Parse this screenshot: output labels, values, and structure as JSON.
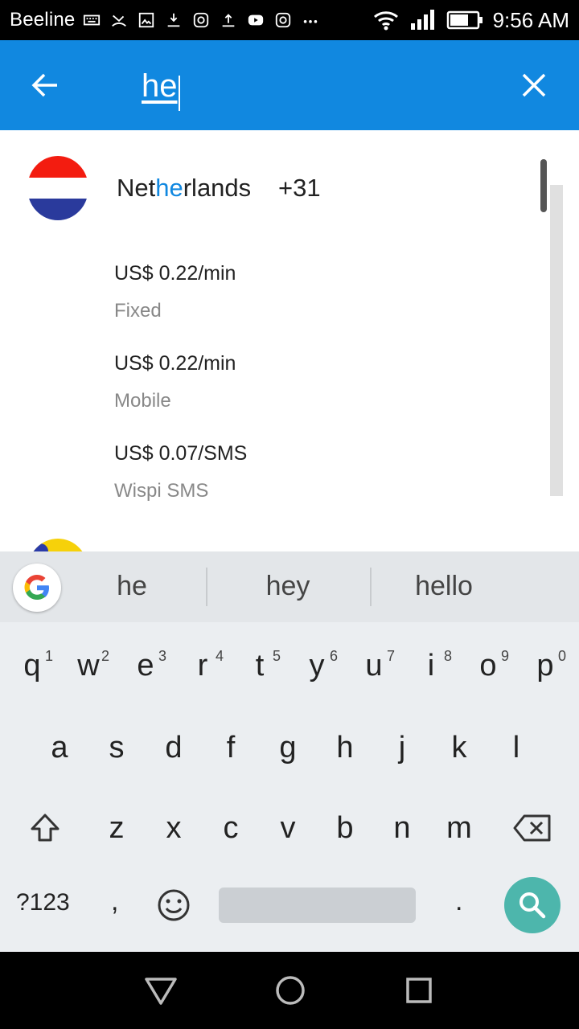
{
  "status_bar": {
    "carrier": "Beeline",
    "time": "9:56 AM"
  },
  "toolbar": {
    "search_value": "he",
    "back_icon": "arrow-left-icon",
    "clear_icon": "close-icon"
  },
  "results": {
    "country_prefix": "Net",
    "country_match": "he",
    "country_suffix": "rlands",
    "dial_code": "+31",
    "rates": [
      {
        "price": "US$ 0.22/min",
        "type": "Fixed"
      },
      {
        "price": "US$ 0.22/min",
        "type": "Mobile"
      },
      {
        "price": "US$ 0.07/SMS",
        "type": "Wispi SMS"
      }
    ]
  },
  "keyboard": {
    "suggestions": [
      "he",
      "hey",
      "hello"
    ],
    "row1": [
      "q",
      "w",
      "e",
      "r",
      "t",
      "y",
      "u",
      "i",
      "o",
      "p"
    ],
    "row1_hints": [
      "1",
      "2",
      "3",
      "4",
      "5",
      "6",
      "7",
      "8",
      "9",
      "0"
    ],
    "row2": [
      "a",
      "s",
      "d",
      "f",
      "g",
      "h",
      "j",
      "k",
      "l"
    ],
    "row3": [
      "z",
      "x",
      "c",
      "v",
      "b",
      "n",
      "m"
    ],
    "symbols_label": "?123",
    "comma": ",",
    "period": "."
  },
  "colors": {
    "toolbar": "#1188e0",
    "highlight": "#1188e0",
    "search_key": "#4db6ac"
  }
}
